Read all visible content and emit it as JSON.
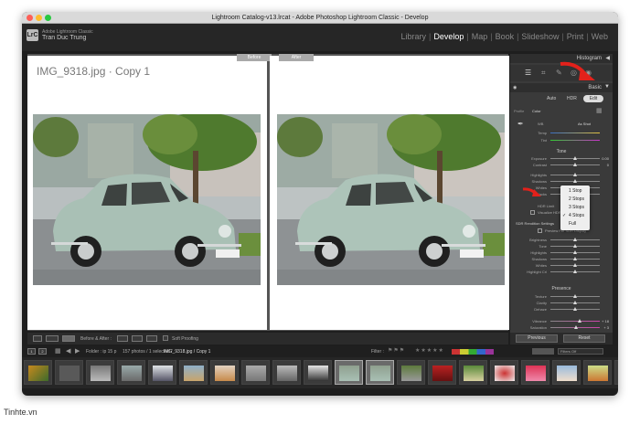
{
  "window": {
    "title": "Lightroom Catalog-v13.lrcat - Adobe Photoshop Lightroom Classic - Develop"
  },
  "identity": {
    "logo": "LrC",
    "app_name": "Adobe Lightroom Classic",
    "user": "Tran Duc Trung"
  },
  "modules": [
    "Library",
    "Develop",
    "Map",
    "Book",
    "Slideshow",
    "Print",
    "Web"
  ],
  "active_module": "Develop",
  "view": {
    "photo_title": "IMG_9318.jpg  ·  Copy 1",
    "before_label": "Before",
    "after_label": "After"
  },
  "toolbar": {
    "before_after_label": "Before & After :",
    "soft_proofing": "Soft Proofing"
  },
  "filmstrip_header": {
    "pages": [
      "1",
      "2"
    ],
    "folder": "Folder : ip 15 p",
    "count": "157 photos / 1 selected /",
    "file": "IMG_9318.jpg / Copy 1",
    "filter_label": "Filter :",
    "filters_off": "Filters Off"
  },
  "right_panel": {
    "histogram": "Histogram",
    "basic": "Basic",
    "treatment": {
      "auto": "Auto",
      "hdr": "HDR",
      "edit": "Edit"
    },
    "profile_label": "Profile",
    "profile_value": "Color",
    "wb_label": "WB",
    "wb_value": "As Shot",
    "temp": "Temp",
    "tint": "Tint",
    "tone": "Tone",
    "exposure": {
      "label": "Exposure",
      "value": "0.00"
    },
    "contrast": {
      "label": "Contrast",
      "value": "0"
    },
    "highlights": "Highlights",
    "shadows": "Shadows",
    "whites": "Whites",
    "blacks": "Blacks",
    "hdr_limit_label": "HDR Limit",
    "hdr_limit_value": "4 Stops",
    "visualize_hdr": "Visualize HDR",
    "sdr_settings": "SDR Rendition Settings",
    "preview_sdr": "Preview For SDR Display",
    "sdr_sliders": [
      "Brightness",
      "Tone",
      "Highlights",
      "Shadows",
      "Whites",
      "Highlight Crl"
    ],
    "presence": "Presence",
    "texture": "Texture",
    "clarity": "Clarity",
    "dehaze": "Dehaze",
    "vibrance": {
      "label": "Vibrance",
      "value": "+ 18"
    },
    "saturation": {
      "label": "Saturation",
      "value": "+ 3"
    },
    "previous": "Previous",
    "reset": "Reset"
  },
  "hdr_limit_menu": {
    "options": [
      "1 Stop",
      "2 Stops",
      "3 Stops",
      "4 Stops",
      "Full"
    ],
    "selected": "4 Stops"
  },
  "watermark": "Tinhte.vn"
}
